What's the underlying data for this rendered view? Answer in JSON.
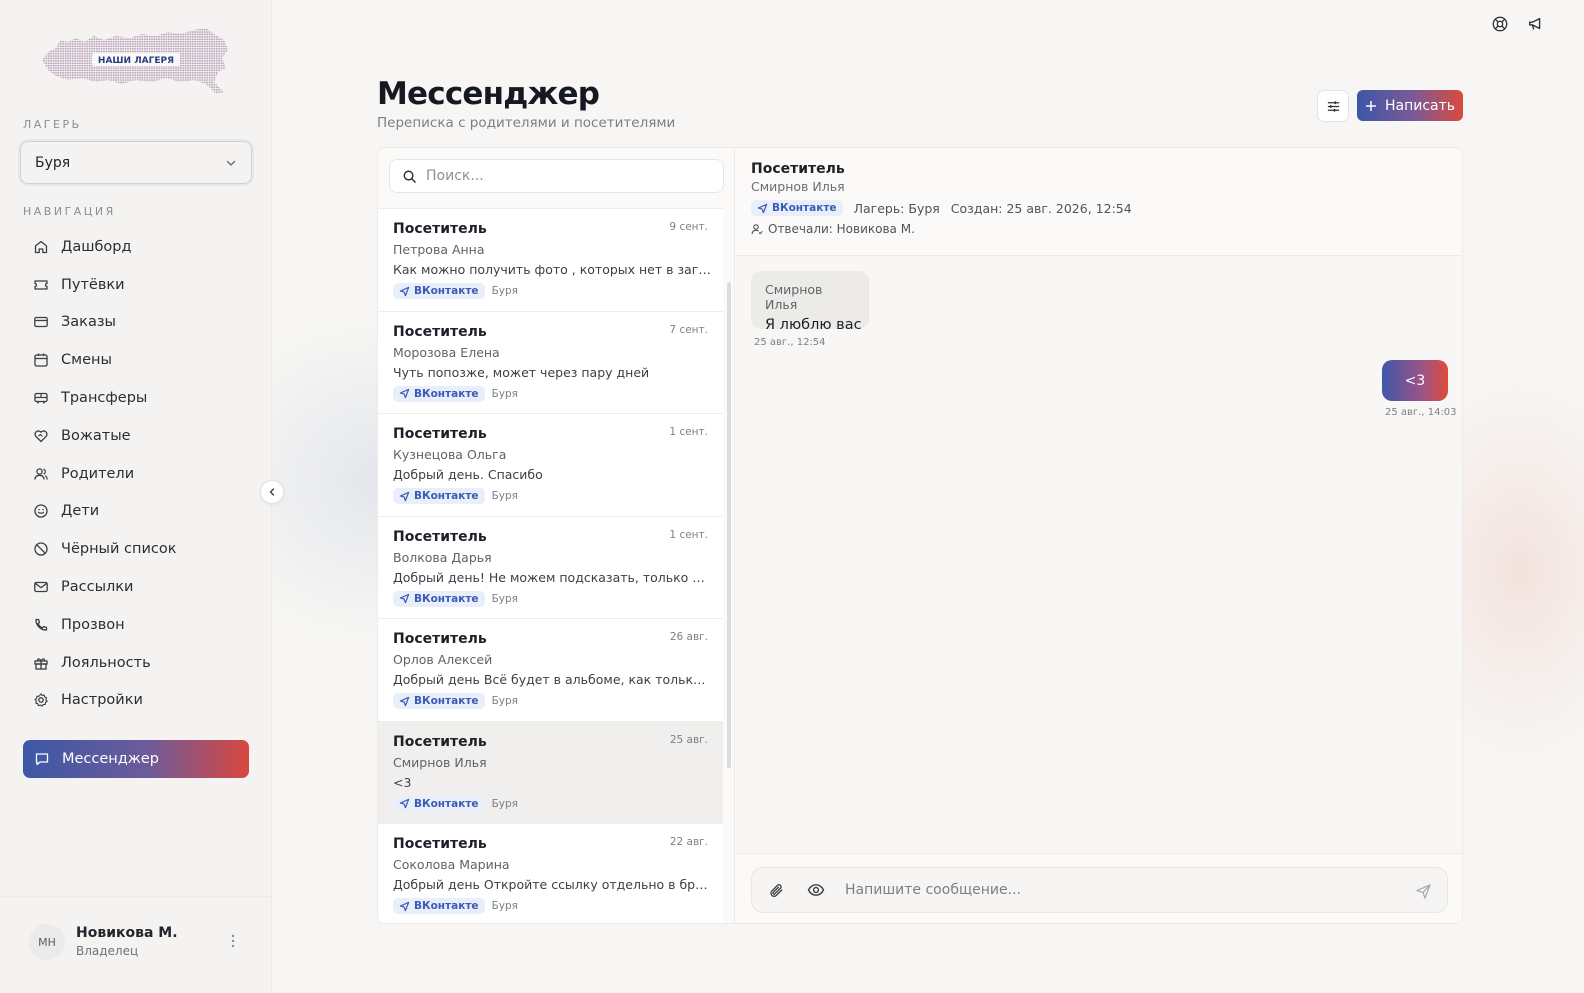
{
  "app": {
    "logo_text": "НАШИ ЛАГЕРЯ"
  },
  "sidebar": {
    "camp_label": "ЛАГЕРЬ",
    "camp_value": "Буря",
    "nav_label": "НАВИГАЦИЯ",
    "items": [
      {
        "label": "Дашборд",
        "icon": "home-icon"
      },
      {
        "label": "Путёвки",
        "icon": "ticket-icon"
      },
      {
        "label": "Заказы",
        "icon": "card-icon"
      },
      {
        "label": "Смены",
        "icon": "calendar-icon"
      },
      {
        "label": "Трансферы",
        "icon": "bus-icon"
      },
      {
        "label": "Вожатые",
        "icon": "heart-handshake-icon"
      },
      {
        "label": "Родители",
        "icon": "users-icon"
      },
      {
        "label": "Дети",
        "icon": "smile-icon"
      },
      {
        "label": "Чёрный список",
        "icon": "ban-icon"
      },
      {
        "label": "Рассылки",
        "icon": "mail-icon"
      },
      {
        "label": "Прозвон",
        "icon": "phone-icon"
      },
      {
        "label": "Лояльность",
        "icon": "gift-icon"
      },
      {
        "label": "Настройки",
        "icon": "gear-icon"
      }
    ],
    "active_item": {
      "label": "Мессенджер",
      "icon": "message-icon"
    },
    "user": {
      "initials": "МН",
      "name": "Новикова М.",
      "role": "Владелец"
    }
  },
  "header": {
    "title": "Мессенджер",
    "subtitle": "Переписка с родителями и посетителями",
    "write_label": "Написать"
  },
  "search": {
    "placeholder": "Поиск..."
  },
  "conversations": [
    {
      "title": "Посетитель",
      "name": "Петрова Анна",
      "date": "9 сент.",
      "preview": "Как можно получить фото , которых нет в загруженных альбомах?",
      "channel": "ВКонтакте",
      "camp": "Буря"
    },
    {
      "title": "Посетитель",
      "name": "Морозова Елена",
      "date": "7 сент.",
      "preview": "Чуть попозже, может через пару дней",
      "channel": "ВКонтакте",
      "camp": "Буря"
    },
    {
      "title": "Посетитель",
      "name": "Кузнецова Ольга",
      "date": "1 сент.",
      "preview": "Добрый день. Спасибо",
      "channel": "ВКонтакте",
      "camp": "Буря"
    },
    {
      "title": "Посетитель",
      "name": "Волкова Дарья",
      "date": "1 сент.",
      "preview": "Добрый день! Не можем подсказать, только если в будние дни",
      "channel": "ВКонтакте",
      "camp": "Буря"
    },
    {
      "title": "Посетитель",
      "name": "Орлов Алексей",
      "date": "26 авг.",
      "preview": "Добрый день Всё будет в альбоме, как только фотограф загрузит",
      "channel": "ВКонтакте",
      "camp": "Буря"
    },
    {
      "title": "Посетитель",
      "name": "Смирнов Илья",
      "date": "25 авг.",
      "preview": "<3",
      "channel": "ВКонтакте",
      "camp": "Буря"
    },
    {
      "title": "Посетитель",
      "name": "Соколова Марина",
      "date": "22 авг.",
      "preview": "Добрый день Откройте ссылку отдельно в браузере, пожалуйста",
      "channel": "ВКонтакте",
      "camp": "Буря"
    }
  ],
  "chat": {
    "title": "Посетитель",
    "name": "Смирнов Илья",
    "channel": "ВКонтакте",
    "camp": "Лагерь: Буря",
    "created": "Создан: 25 авг. 2026, 12:54",
    "replied": "Отвечали: Новикова М.",
    "messages": [
      {
        "direction": "in",
        "from": "Смирнов Илья",
        "text": "Я люблю вас",
        "time": "25 авг., 12:54"
      },
      {
        "direction": "out",
        "text": "<3",
        "time": "25 авг., 14:03"
      }
    ],
    "composer_placeholder": "Напишите сообщение..."
  },
  "colors": {
    "accent_blue": "#3d57a6",
    "accent_red": "#d9473f",
    "badge_bg": "#e9eefb",
    "badge_text": "#3b5bb5"
  }
}
